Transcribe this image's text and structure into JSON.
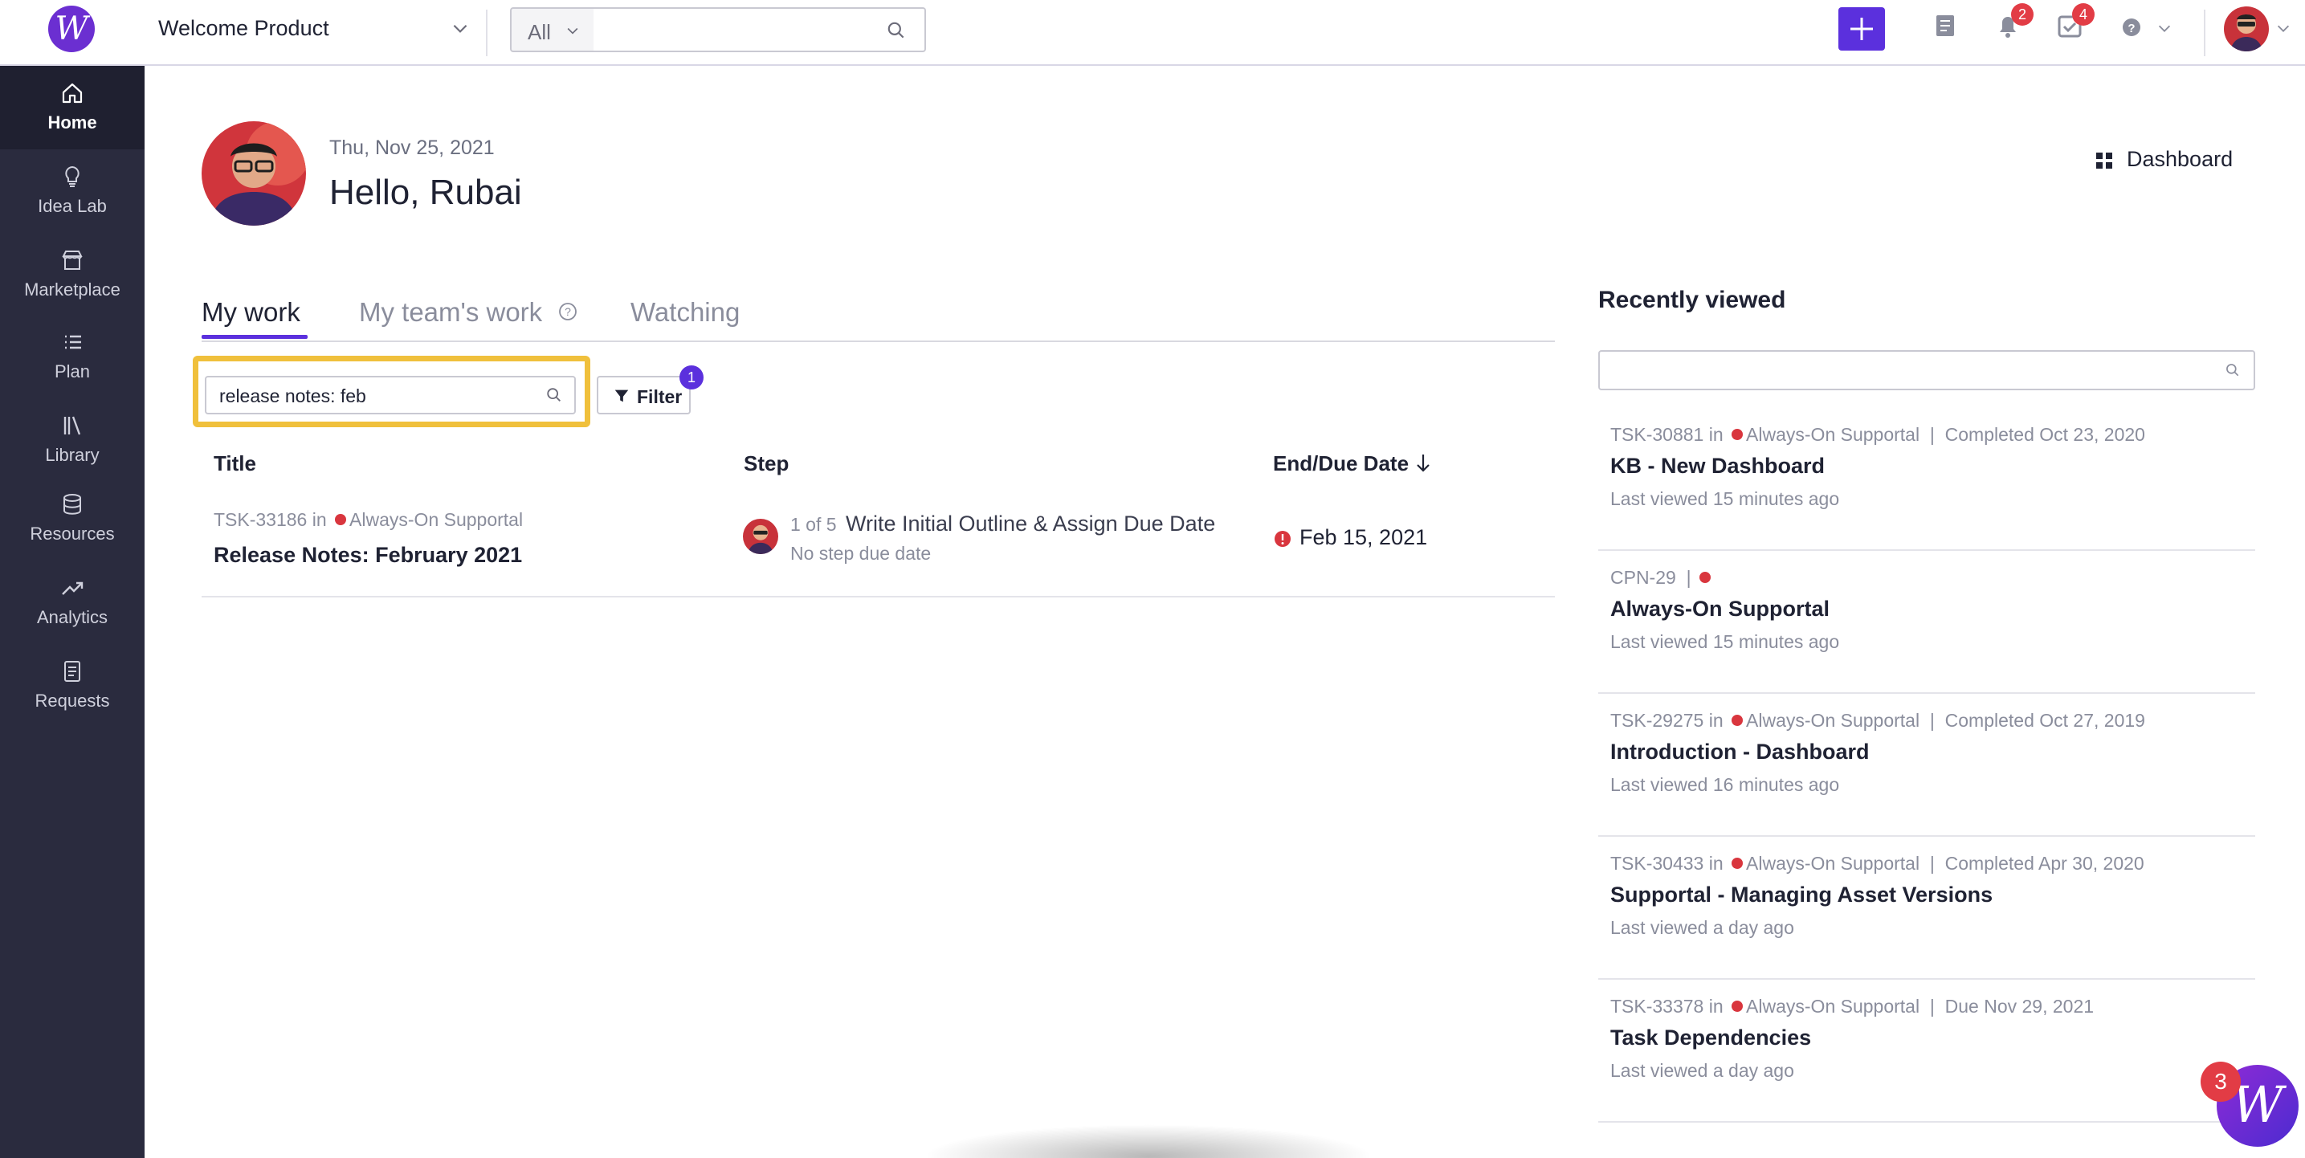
{
  "topbar": {
    "logo_letter": "W",
    "product": "Welcome Product",
    "search_scope": "All",
    "search_placeholder": "",
    "notifications_count": "2",
    "tasks_count": "4",
    "colors": {
      "accent": "#5b30dd",
      "badge": "#e23c45"
    }
  },
  "sidebar": {
    "items": [
      {
        "label": "Home",
        "icon": "home-icon"
      },
      {
        "label": "Idea Lab",
        "icon": "lightbulb-icon"
      },
      {
        "label": "Marketplace",
        "icon": "store-icon"
      },
      {
        "label": "Plan",
        "icon": "list-icon"
      },
      {
        "label": "Library",
        "icon": "library-icon"
      },
      {
        "label": "Resources",
        "icon": "database-icon"
      },
      {
        "label": "Analytics",
        "icon": "trend-icon"
      },
      {
        "label": "Requests",
        "icon": "document-icon"
      }
    ]
  },
  "header": {
    "date": "Thu, Nov 25, 2021",
    "greeting": "Hello, Rubai",
    "dashboard_label": "Dashboard"
  },
  "tabs": [
    {
      "label": "My work"
    },
    {
      "label": "My team's work"
    },
    {
      "label": "Watching"
    }
  ],
  "mywork": {
    "search_value": "release notes: feb",
    "filter_label": "Filter",
    "filter_count": "1",
    "columns": {
      "title": "Title",
      "step": "Step",
      "due": "End/Due Date"
    },
    "rows": [
      {
        "id": "TSK-33186",
        "in": "in",
        "project": "Always-On Supportal",
        "title": "Release Notes: February 2021",
        "step_count": "1 of 5",
        "step_name": "Write Initial Outline & Assign Due Date",
        "step_due": "No step due date",
        "due_date": "Feb 15, 2021"
      }
    ]
  },
  "recently_viewed": {
    "title": "Recently viewed",
    "items": [
      {
        "id": "TSK-30881",
        "in": "in",
        "project": "Always-On Supportal",
        "status": "Completed Oct 23, 2020",
        "name": "KB - New Dashboard",
        "last": "Last viewed 15 minutes ago"
      },
      {
        "id": "CPN-29",
        "in": "",
        "project": "",
        "status": "",
        "name": "Always-On Supportal",
        "last": "Last viewed 15 minutes ago"
      },
      {
        "id": "TSK-29275",
        "in": "in",
        "project": "Always-On Supportal",
        "status": "Completed Oct 27, 2019",
        "name": "Introduction - Dashboard",
        "last": "Last viewed 16 minutes ago"
      },
      {
        "id": "TSK-30433",
        "in": "in",
        "project": "Always-On Supportal",
        "status": "Completed Apr 30, 2020",
        "name": "Supportal - Managing Asset Versions",
        "last": "Last viewed a day ago"
      },
      {
        "id": "TSK-33378",
        "in": "in",
        "project": "Always-On Supportal",
        "status": "Due Nov 29, 2021",
        "name": "Task Dependencies",
        "last": "Last viewed a day ago"
      }
    ]
  },
  "chat": {
    "letter": "W",
    "count": "3"
  }
}
